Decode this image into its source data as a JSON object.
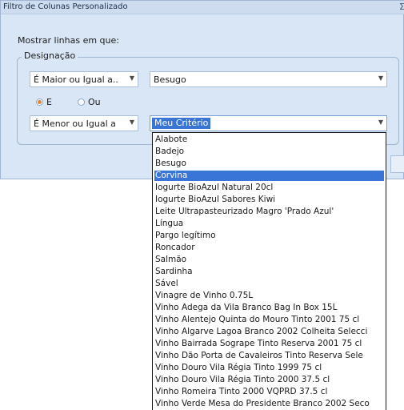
{
  "dialog": {
    "title": "Filtro de Colunas Personalizado",
    "close_glyph": "Σ",
    "prompt": "Mostrar linhas em que:",
    "group_label": "Designação"
  },
  "row1": {
    "operator": "É Maior ou Igual a..",
    "value": "Besugo"
  },
  "logic": {
    "and_label": "E",
    "or_label": "Ou",
    "selected": "E"
  },
  "row2": {
    "operator": "É Menor ou Igual a",
    "value": "Meu Critério"
  },
  "dropdown": {
    "highlighted": "Corvina",
    "items": [
      "Alabote",
      "Badejo",
      "Besugo",
      "Corvina",
      "Iogurte BioAzul Natural 20cl",
      "Iogurte BioAzul Sabores Kiwi",
      "Leite Ultrapasteurizado Magro 'Prado Azul'",
      "Língua",
      "Pargo legítimo",
      "Roncador",
      "Salmão",
      "Sardinha",
      "Sável",
      "Vinagre de Vinho 0.75L",
      "Vinho Adega da Vila Branco Bag In Box 15L",
      "Vinho Alentejo Quinta do Mouro Tinto 2001 75 cl",
      "Vinho Algarve Lagoa Branco 2002 Colheita Selecci",
      "Vinho Bairrada Sogrape Tinto Reserva 2001 75 cl",
      "Vinho Dão Porta de Cavaleiros Tinto Reserva Sele",
      "Vinho Douro Vila Régia Tinto 1999 75 cl",
      "Vinho Douro Vila Régia Tinto 2000 37.5 cl",
      "Vinho Romeira Tinto 2000 VQPRD 37.5 cl",
      "Vinho Verde Mesa do Presidente Branco 2002 Seco"
    ]
  }
}
